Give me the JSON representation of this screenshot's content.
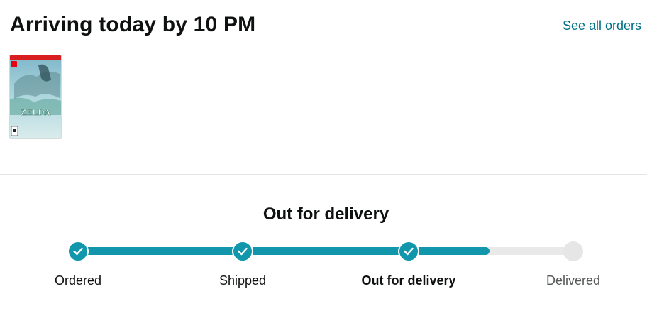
{
  "header": {
    "title": "Arriving today by 10 PM",
    "see_all_label": "See all orders"
  },
  "product": {
    "image": "zelda-tears-of-the-kingdom-cover",
    "cover_text": "ZELDA"
  },
  "tracking": {
    "status_title": "Out for delivery",
    "progress": 0.83,
    "steps": [
      {
        "label": "Ordered",
        "state": "done"
      },
      {
        "label": "Shipped",
        "state": "done"
      },
      {
        "label": "Out for delivery",
        "state": "current"
      },
      {
        "label": "Delivered",
        "state": "pending"
      }
    ]
  },
  "colors": {
    "accent": "#1196ab",
    "link": "#007185",
    "track_inactive": "#e9e9e9",
    "text": "#0f1111",
    "muted": "#565959"
  }
}
